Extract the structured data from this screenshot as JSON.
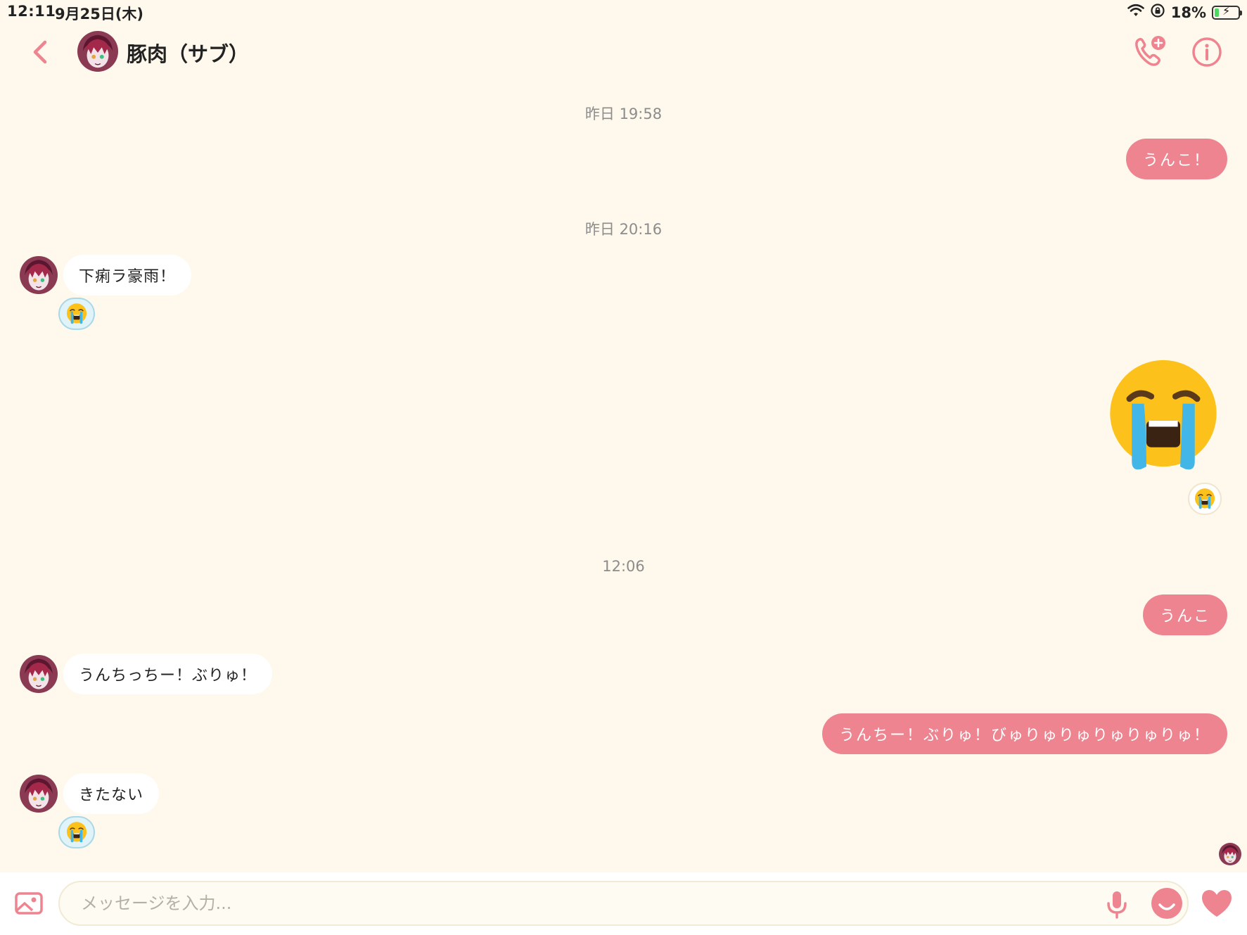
{
  "status_bar": {
    "time": "12:11",
    "date": "9月25日(木)",
    "battery": "18%",
    "battery_level": 0.18
  },
  "header": {
    "title": "豚肉（サブ）"
  },
  "chat": {
    "timestamp_1": "昨日 19:58",
    "msg_out_1": "うんこ！",
    "timestamp_2": "昨日 20:16",
    "msg_in_1": "下痢ラ豪雨！",
    "timestamp_3": "12:06",
    "msg_out_3": "うんこ",
    "msg_in_2": "うんちっちー！ぶりゅ！",
    "msg_out_4": "うんちー！ぶりゅ！びゅりゅりゅりゅりゅりゅ！",
    "msg_in_3": "きたない"
  },
  "input": {
    "placeholder": "メッセージを入力..."
  },
  "colors": {
    "accent": "#ef8491",
    "background": "#fef9ec",
    "timestamp": "#8c8c8c"
  },
  "icons": [
    "chevron-left-icon",
    "phone-add-icon",
    "info-icon",
    "gallery-icon",
    "microphone-icon",
    "emoji-icon",
    "heart-icon",
    "loudly-crying-face-icon",
    "wifi-icon",
    "orientation-lock-icon",
    "battery-icon"
  ]
}
